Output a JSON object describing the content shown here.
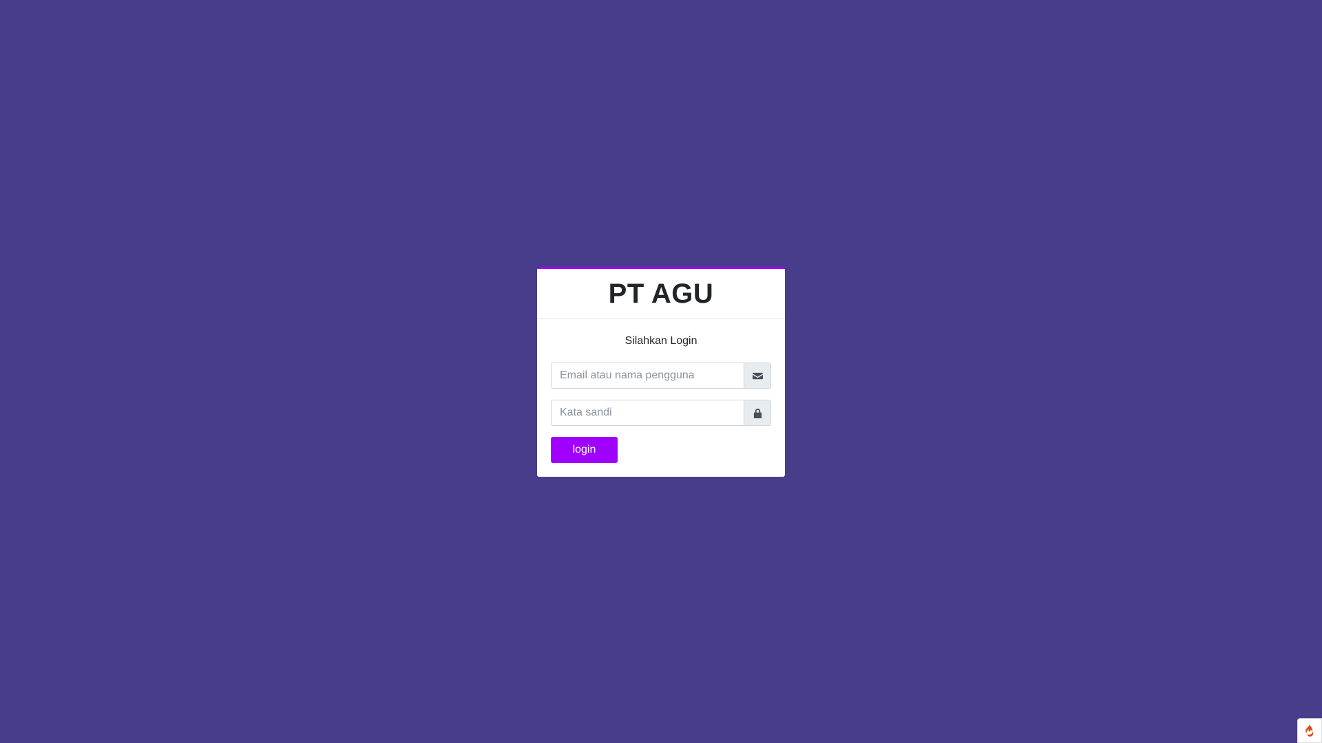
{
  "brand": {
    "title": "PT AGU"
  },
  "login": {
    "message": "Silahkan Login",
    "username": {
      "placeholder": "Email atau nama pengguna",
      "value": "",
      "icon": "envelope-icon"
    },
    "password": {
      "placeholder": "Kata sandi",
      "value": "",
      "icon": "lock-icon"
    },
    "submit_label": "login"
  },
  "debug_toolbar": {
    "icon": "flame-icon"
  },
  "colors": {
    "background": "#483d8b",
    "accent": "#a000ff",
    "card": "#ffffff"
  }
}
